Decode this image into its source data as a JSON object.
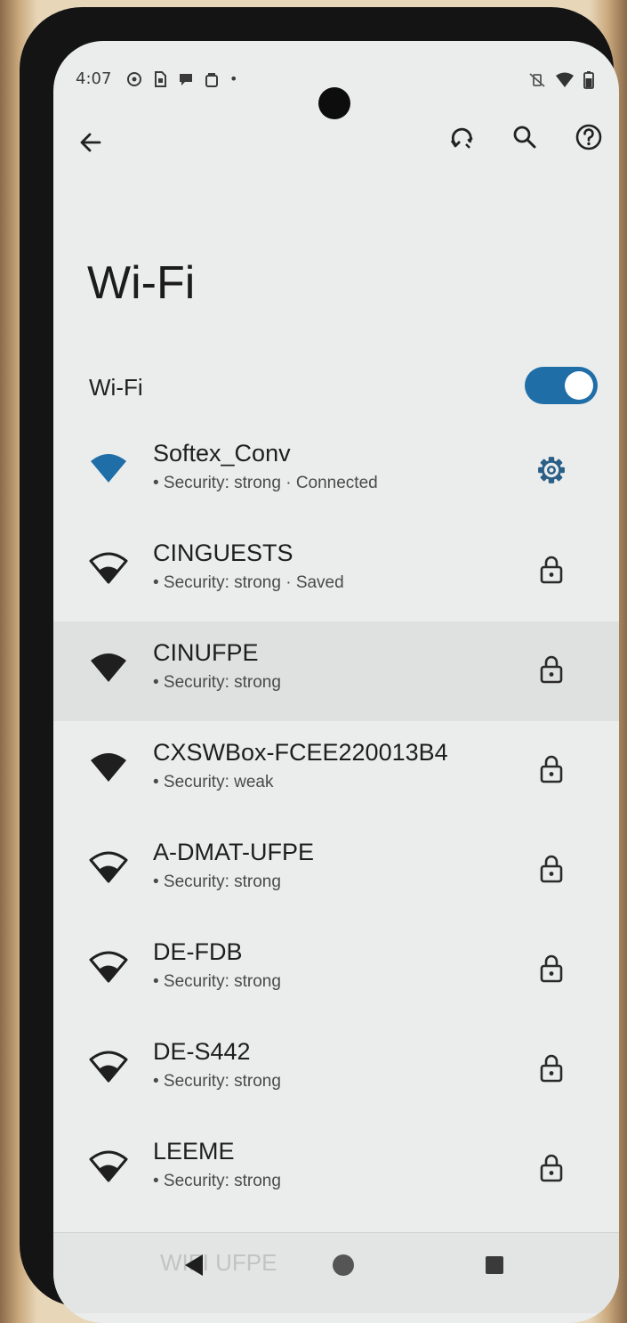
{
  "status_bar": {
    "time": "4:07",
    "left_icons": [
      "sync-icon",
      "sim-icon",
      "message-icon",
      "bag-icon"
    ],
    "dot": "•",
    "right_icons": [
      "vibrate-off-icon",
      "wifi-signal-icon",
      "battery-icon"
    ]
  },
  "toolbar": {
    "back_icon": "back-arrow-icon",
    "actions": [
      "refresh-icon",
      "search-icon",
      "help-icon"
    ]
  },
  "page": {
    "title": "Wi-Fi",
    "master_label": "Wi-Fi",
    "master_enabled": true
  },
  "colors": {
    "accent": "#1f6ea8",
    "background": "#ebedec",
    "text": "#1e1e1e"
  },
  "networks": [
    {
      "name": "Softex_Conv",
      "sub": "• Security: strong · Connected",
      "icon": "wifi-filled",
      "action": "gear-icon",
      "connected": true
    },
    {
      "name": "CINGUESTS",
      "sub": "• Security: strong · Saved",
      "icon": "wifi-outline",
      "action": "lock-icon"
    },
    {
      "name": "CINUFPE",
      "sub": "• Security: strong",
      "icon": "wifi-filled",
      "action": "lock-icon",
      "highlighted": true
    },
    {
      "name": "CXSWBox-FCEE220013B4",
      "sub": "• Security: weak",
      "icon": "wifi-filled",
      "action": "lock-icon"
    },
    {
      "name": "A-DMAT-UFPE",
      "sub": "• Security: strong",
      "icon": "wifi-outline",
      "action": "lock-icon"
    },
    {
      "name": "DE-FDB",
      "sub": "• Security: strong",
      "icon": "wifi-outline",
      "action": "lock-icon"
    },
    {
      "name": "DE-S442",
      "sub": "• Security: strong",
      "icon": "wifi-outline",
      "action": "lock-icon"
    },
    {
      "name": "LEEME",
      "sub": "• Security: strong",
      "icon": "wifi-outline",
      "action": "lock-icon"
    }
  ],
  "partial_network": "WIFI UFPE",
  "nav": [
    "back-triangle-icon",
    "home-circle-icon",
    "recents-square-icon"
  ]
}
